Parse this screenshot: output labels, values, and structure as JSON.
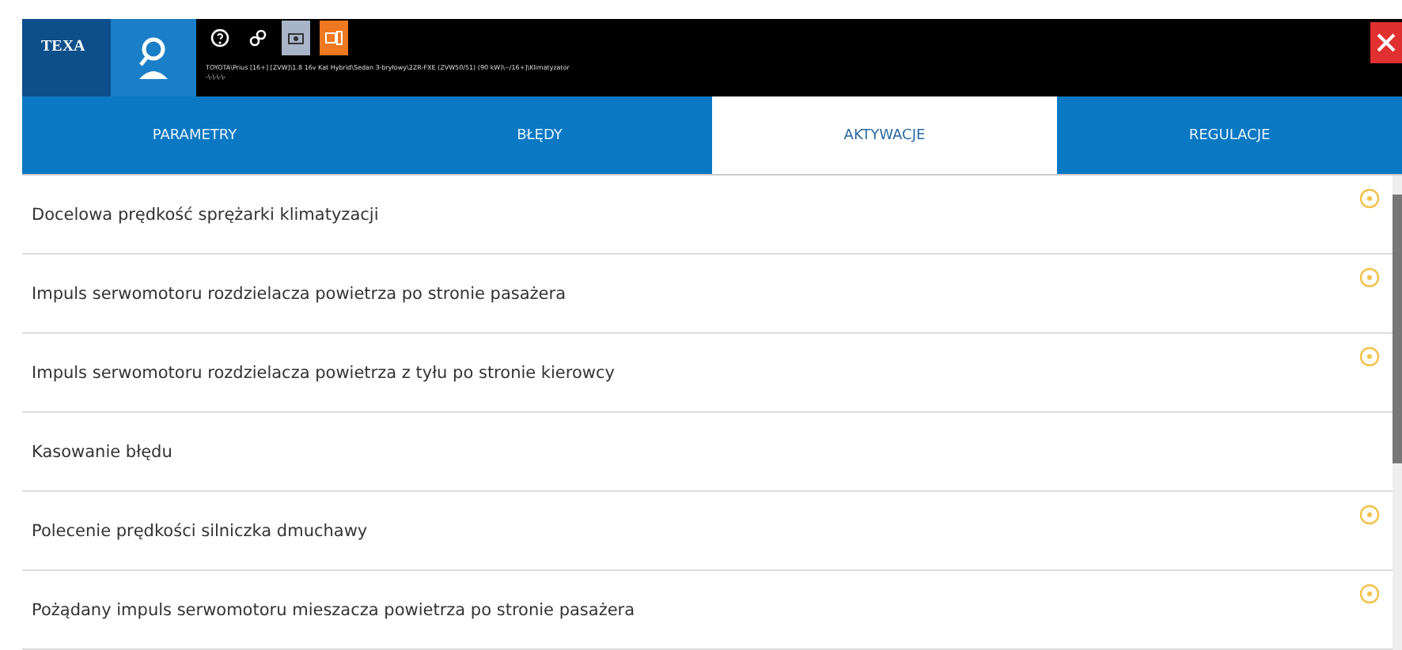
{
  "header": {
    "logo": "TEXA",
    "breadcrumb": "TOYOTA\\Prius [16+] [ZVW]\\1.8 16v Kat Hybrid\\Sedan 3-bryłowy\\2ZR-FXE (ZVW50/51) (90 kW)\\--/16+]\\Klimatyzator",
    "breadcrumb_sub": "-\\-\\-\\-\\-"
  },
  "tabs": [
    {
      "label": "PARAMETRY",
      "selected": false
    },
    {
      "label": "BŁĘDY",
      "selected": false
    },
    {
      "label": "AKTYWACJE",
      "selected": true
    },
    {
      "label": "REGULACJE",
      "selected": false
    }
  ],
  "rows": [
    {
      "label": "Docelowa prędkość sprężarki klimatyzacji",
      "info": true
    },
    {
      "label": "Impuls serwomotoru rozdzielacza powietrza po stronie pasażera",
      "info": true
    },
    {
      "label": "Impuls serwomotoru rozdzielacza powietrza z tyłu po stronie kierowcy",
      "info": true
    },
    {
      "label": "Kasowanie błędu",
      "info": false
    },
    {
      "label": "Polecenie prędkości silniczka dmuchawy",
      "info": true
    },
    {
      "label": "Pożądany impuls serwomotoru mieszacza powietrza po stronie pasażera",
      "info": true
    }
  ]
}
